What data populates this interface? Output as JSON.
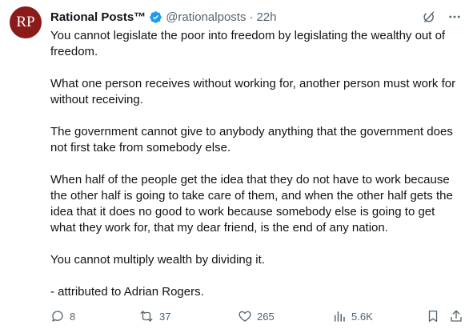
{
  "author": {
    "avatar_text": "RP",
    "name": "Rational Posts™",
    "handle": "@rationalposts",
    "separator": "·",
    "time": "22h"
  },
  "paragraphs": [
    "You cannot legislate the poor into freedom by legislating the wealthy out of freedom.",
    "What one person receives without working for, another person must work for without receiving.",
    "The government cannot give to anybody anything that the government does not first take from somebody else.",
    "When half of the people get the idea that they do not have to work because the other half is going to take care of them, and when the other half gets the idea that it does no good to work because somebody else is going to get what they work for, that my dear friend, is the end of any nation.",
    "You cannot multiply wealth by dividing it.",
    "- attributed to Adrian Rogers."
  ],
  "actions": {
    "replies": "8",
    "reposts": "37",
    "likes": "265",
    "views": "5.6K"
  },
  "colors": {
    "avatar_bg": "#8b1a1a",
    "verified": "#1d9bf0",
    "muted": "#536471",
    "text": "#0f1419"
  },
  "icons": [
    "verified-badge-icon",
    "grok-icon",
    "more-icon",
    "reply-icon",
    "repost-icon",
    "like-icon",
    "views-icon",
    "bookmark-icon",
    "share-icon"
  ]
}
